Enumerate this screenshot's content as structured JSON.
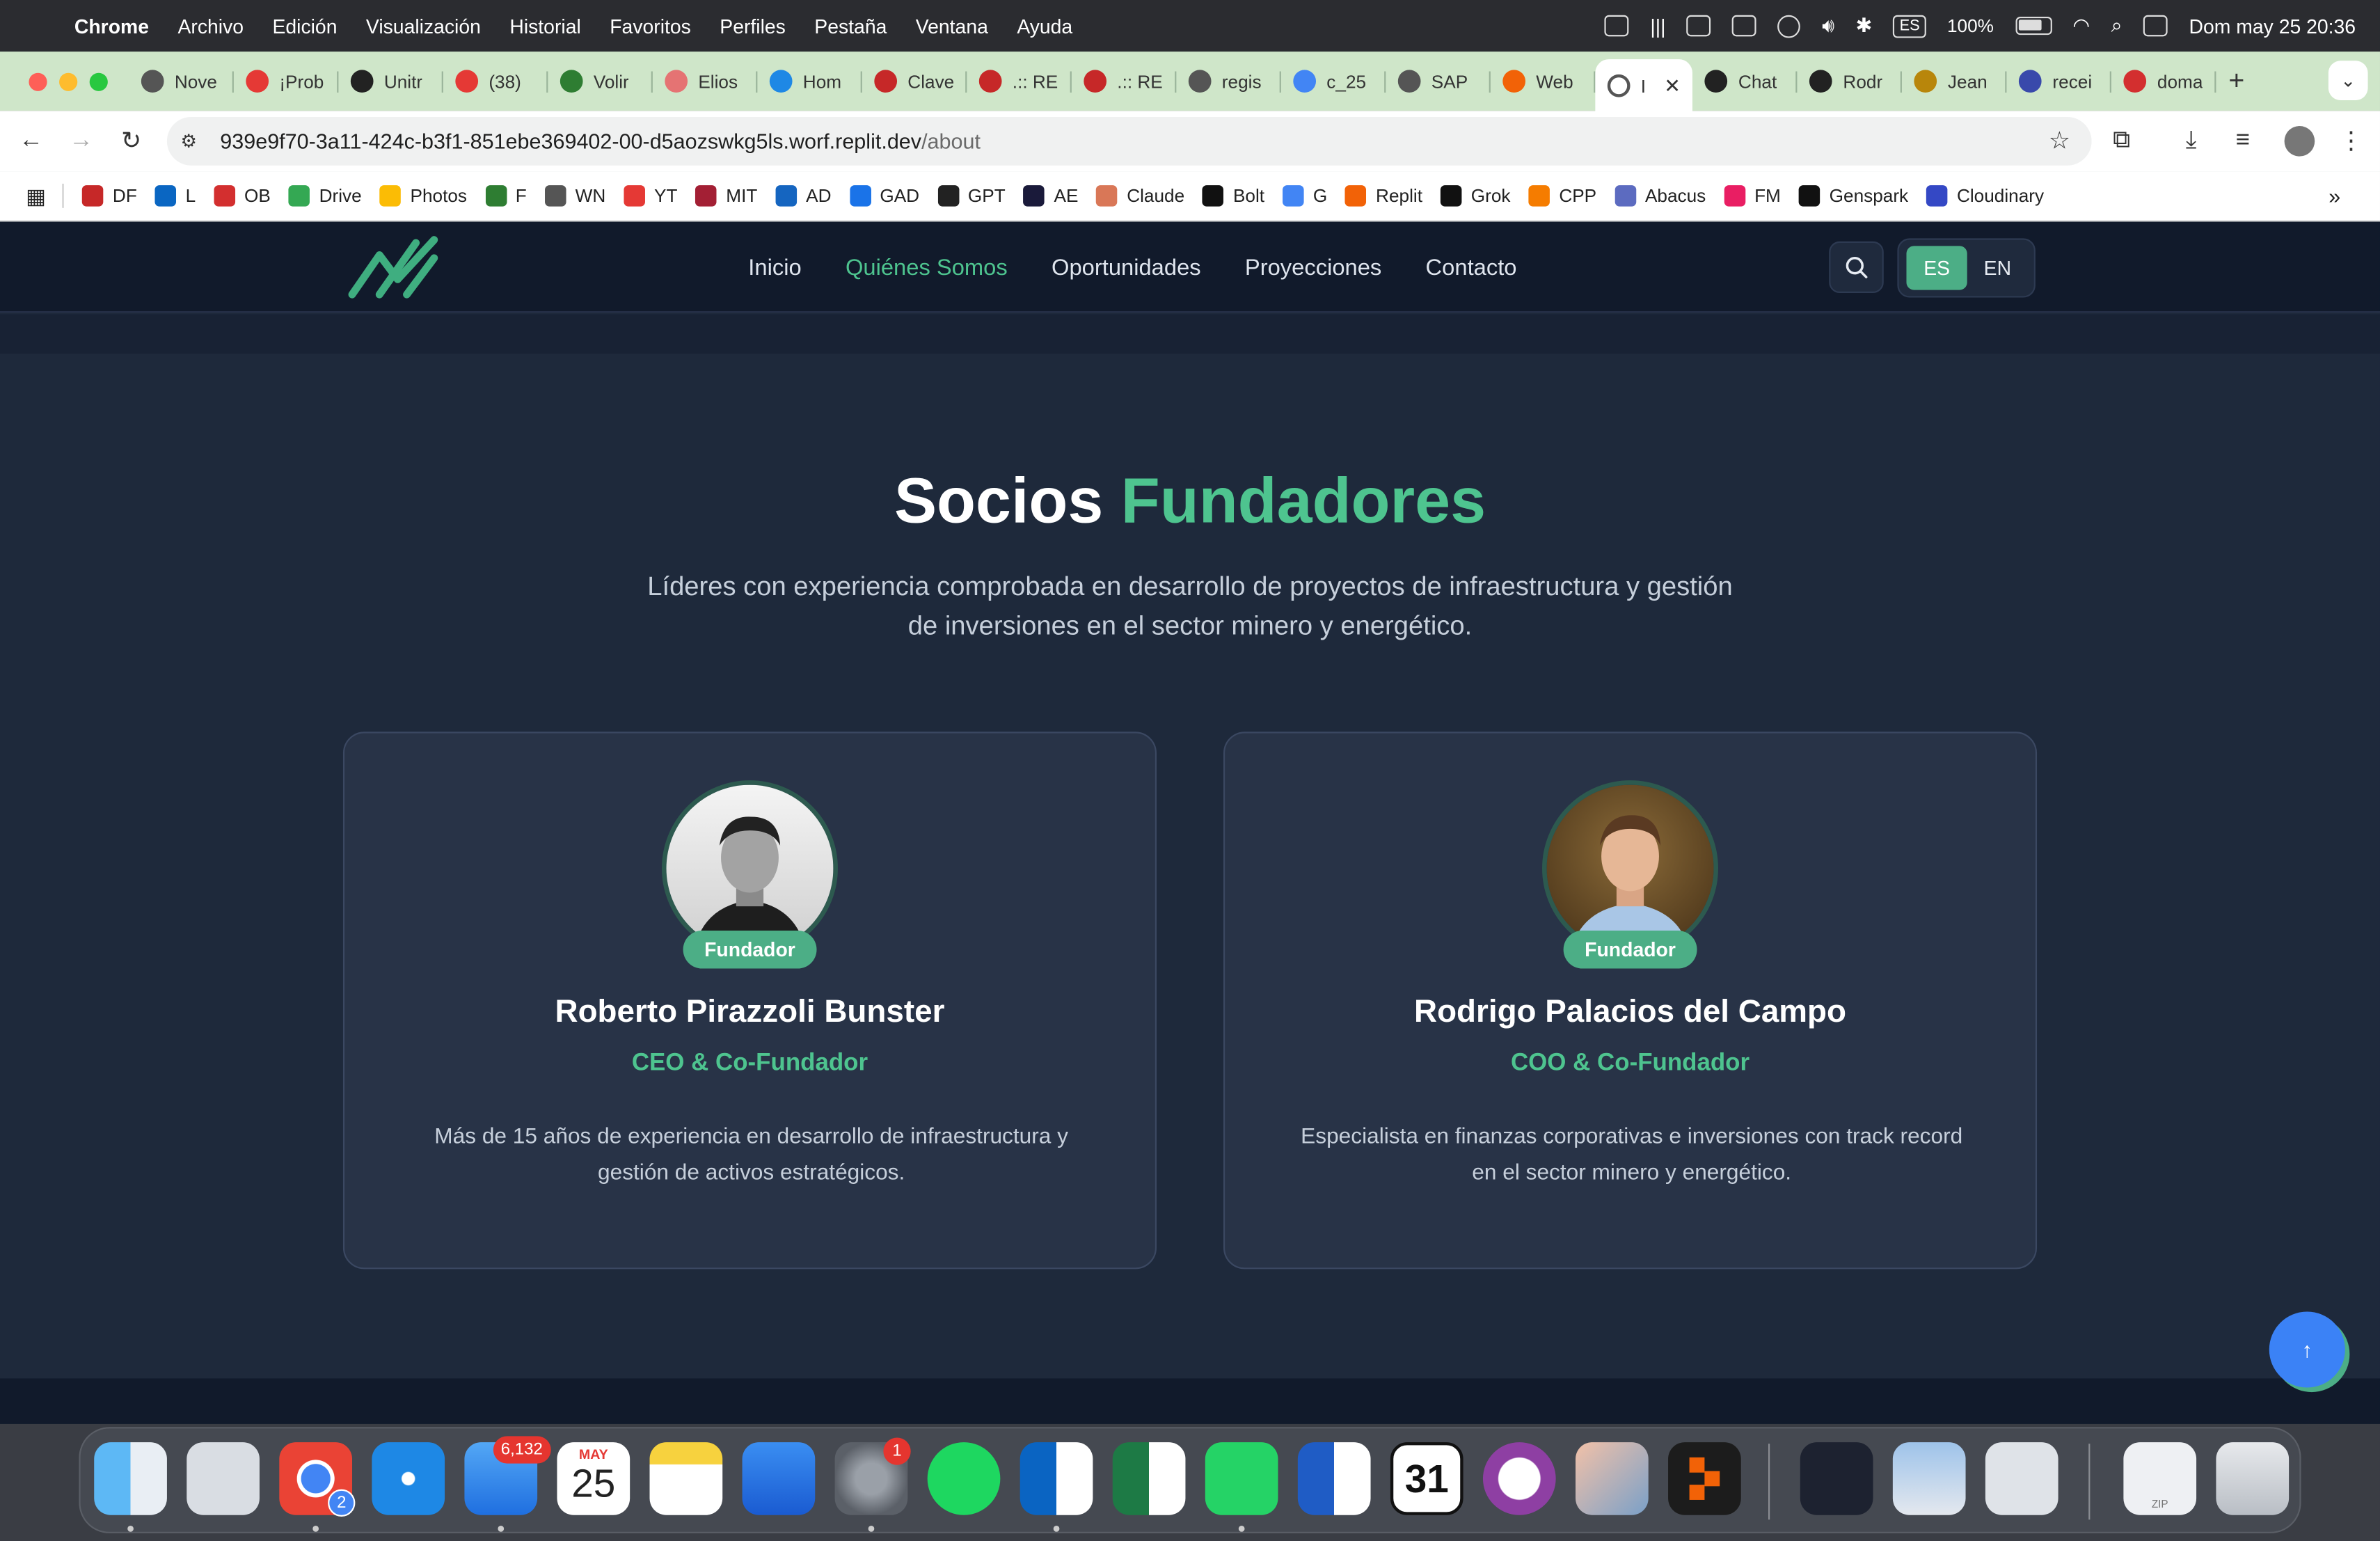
{
  "menubar": {
    "app": "Chrome",
    "items": [
      "Archivo",
      "Edición",
      "Visualización",
      "Historial",
      "Favoritos",
      "Perfiles",
      "Pestaña",
      "Ventana",
      "Ayuda"
    ],
    "input_source": "ES",
    "battery": "100%",
    "datetime": "Dom may 25  20:36"
  },
  "tabs": [
    {
      "label": "Nove",
      "color": "#555"
    },
    {
      "label": "¡Prob",
      "color": "#e53935"
    },
    {
      "label": "Unitr",
      "color": "#222"
    },
    {
      "label": "(38)",
      "color": "#e53935"
    },
    {
      "label": "Volir",
      "color": "#2e7d32"
    },
    {
      "label": "Elios",
      "color": "#e57373"
    },
    {
      "label": "Hom",
      "color": "#1e88e5"
    },
    {
      "label": "Clave",
      "color": "#c62828"
    },
    {
      "label": ".:: RE",
      "color": "#c62828"
    },
    {
      "label": ".:: RE",
      "color": "#c62828"
    },
    {
      "label": "regis",
      "color": "#555"
    },
    {
      "label": "c_25",
      "color": "#4285f4"
    },
    {
      "label": "SAP",
      "color": "#555"
    },
    {
      "label": "Web",
      "color": "#f26207"
    }
  ],
  "active_tab": {
    "label": "I"
  },
  "tabs_after": [
    {
      "label": "Chat",
      "color": "#222"
    },
    {
      "label": "Rodr",
      "color": "#222"
    },
    {
      "label": "Jean",
      "color": "#b8860b"
    },
    {
      "label": "recei",
      "color": "#3949ab"
    },
    {
      "label": "doma",
      "color": "#d32f2f"
    }
  ],
  "omnibox": {
    "host": "939e9f70-3a11-424c-b3f1-851ebe369402-00-d5aozswkg5ls.worf.replit.dev",
    "path": "/about"
  },
  "bookmarks": [
    {
      "label": "DF",
      "color": "#c62828"
    },
    {
      "label": "L",
      "color": "#0a66c2"
    },
    {
      "label": "OB",
      "color": "#d32f2f"
    },
    {
      "label": "Drive",
      "color": "#34a853"
    },
    {
      "label": "Photos",
      "color": "#fbbc05"
    },
    {
      "label": "F",
      "color": "#2e7d32"
    },
    {
      "label": "WN",
      "color": "#555"
    },
    {
      "label": "YT",
      "color": "#e53935"
    },
    {
      "label": "MIT",
      "color": "#a31f34"
    },
    {
      "label": "AD",
      "color": "#1565c0"
    },
    {
      "label": "GAD",
      "color": "#1a73e8"
    },
    {
      "label": "GPT",
      "color": "#222"
    },
    {
      "label": "AE",
      "color": "#1a1a3a"
    },
    {
      "label": "Claude",
      "color": "#d97757"
    },
    {
      "label": "Bolt",
      "color": "#111"
    },
    {
      "label": "G",
      "color": "#4285f4"
    },
    {
      "label": "Replit",
      "color": "#f26207"
    },
    {
      "label": "Grok",
      "color": "#111"
    },
    {
      "label": "CPP",
      "color": "#f57c00"
    },
    {
      "label": "Abacus",
      "color": "#5c6bc0"
    },
    {
      "label": "FM",
      "color": "#e91e63"
    },
    {
      "label": "Genspark",
      "color": "#111"
    },
    {
      "label": "Cloudinary",
      "color": "#3448c5"
    }
  ],
  "site": {
    "nav": [
      "Inicio",
      "Quiénes Somos",
      "Oportunidades",
      "Proyecciones",
      "Contacto"
    ],
    "active_nav": "Quiénes Somos",
    "lang_es": "ES",
    "lang_en": "EN",
    "heading_white": "Socios",
    "heading_green": "Fundadores",
    "lead": "Líderes con experiencia comprobada en desarrollo de proyectos de infraestructura y gestión de inversiones en el sector minero y energético.",
    "founders": [
      {
        "badge": "Fundador",
        "name": "Roberto Pirazzoli Bunster",
        "role": "CEO & Co-Fundador",
        "desc": "Más de 15 años de experiencia en desarrollo de infraestructura y gestión de activos estratégicos."
      },
      {
        "badge": "Fundador",
        "name": "Rodrigo Palacios del Campo",
        "role": "COO & Co-Fundador",
        "desc": "Especialista en finanzas corporativas e inversiones con track record en el sector minero y energético."
      }
    ],
    "accent": "#4ec48f",
    "background": "#1e293b"
  },
  "dock": {
    "mail_badge": "6,132",
    "calendar_month": "MAY",
    "calendar_day": "25",
    "chrome_badge": "2",
    "settings_badge": "1",
    "calendar2_day": "31",
    "zip_label": "ZIP"
  }
}
